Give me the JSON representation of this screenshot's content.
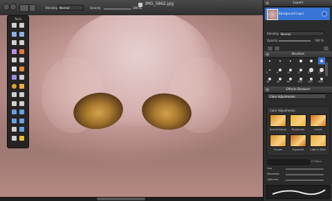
{
  "window": {
    "title": "IMG_5862.jpg"
  },
  "toolbar": {
    "blending_label": "Blending",
    "blending_value": "Normal",
    "opacity_label": "Opacity",
    "opacity_value": "100 %"
  },
  "tools_palette": {
    "title": "Tools",
    "tools": [
      "move-icon",
      "zoom-icon",
      "rect-select-icon",
      "ellipse-select-icon",
      "lasso-icon",
      "polygon-lasso-icon",
      "magic-wand-icon",
      "eyedropper-icon",
      "crop-icon",
      "line-icon",
      "eraser-icon",
      "pencil-icon",
      "gradient-icon",
      "paint-bucket-icon",
      "clone-stamp-icon",
      "brush-icon",
      "heal-icon",
      "burn-icon",
      "smudge-icon",
      "dodge-icon",
      "dropper-icon",
      "blur-icon",
      "sharpen-icon",
      "pen-icon",
      "text-icon",
      "star-shape-icon",
      "zoom-tool-icon",
      "color-picker-icon"
    ]
  },
  "layers_panel": {
    "title": "Layers",
    "layer_name": "Background Layer",
    "blending_label": "Blending",
    "blending_value": "Normal",
    "opacity_label": "Opacity",
    "opacity_value": "100 %"
  },
  "brushes_panel": {
    "title": "Brushes",
    "brushes": [
      "1",
      "3",
      "5",
      "9",
      "13",
      "19",
      "5",
      "9",
      "13",
      "17",
      "21",
      "27",
      "35",
      "45",
      "65",
      "100",
      "200",
      "300"
    ],
    "selected_index": 5
  },
  "effects_panel": {
    "title": "Effects Browser",
    "category": "Color Adjustments",
    "section_label": "Color Adjustments",
    "effects": [
      {
        "label": "Auto Enhance",
        "color": "#e08a1e"
      },
      {
        "label": "Brightness",
        "color": "#f0b030"
      },
      {
        "label": "Levels",
        "color": "#d4701a"
      },
      {
        "label": "Curves",
        "color": "#e09028"
      },
      {
        "label": "Exposure",
        "color": "#c86a18"
      },
      {
        "label": "Light & Dark",
        "color": "#f2a83a"
      }
    ],
    "filter_count": "13 filters",
    "sliders": [
      {
        "label": "Hue"
      },
      {
        "label": "Saturation"
      },
      {
        "label": "Lightness"
      }
    ]
  },
  "colors": {
    "selection": "#3875d7",
    "accent": "#f0a030"
  }
}
